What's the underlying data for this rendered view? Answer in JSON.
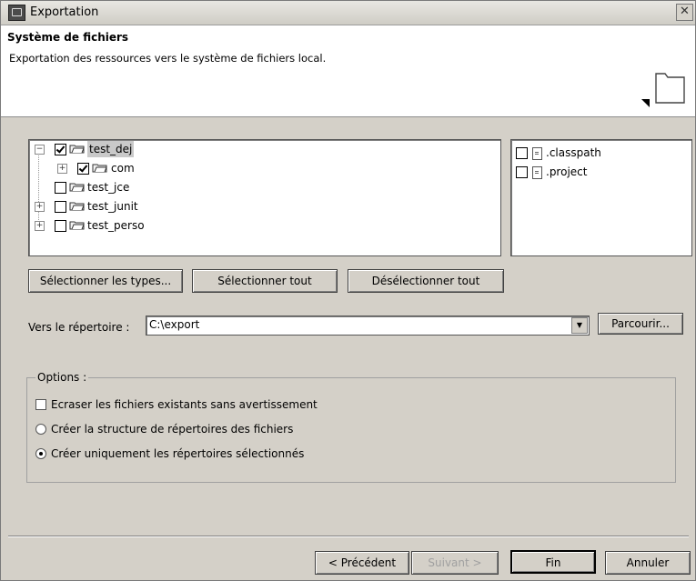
{
  "window": {
    "title": "Exportation"
  },
  "header": {
    "title": "Système de fichiers",
    "description": "Exportation des ressources vers le système de fichiers local."
  },
  "tree": [
    {
      "label": "test_dej",
      "checked": true,
      "expanded": true,
      "level": 0
    },
    {
      "label": "com",
      "checked": true,
      "expanded": false,
      "level": 1
    },
    {
      "label": "test_jce",
      "checked": false,
      "level": 0
    },
    {
      "label": "test_junit",
      "checked": false,
      "expanded": false,
      "level": 0
    },
    {
      "label": "test_perso",
      "checked": false,
      "expanded": false,
      "level": 0
    }
  ],
  "files": [
    {
      "label": ".classpath",
      "checked": false
    },
    {
      "label": ".project",
      "checked": false
    }
  ],
  "buttons": {
    "select_types": "Sélectionner les types...",
    "select_all": "Sélectionner tout",
    "deselect_all": "Désélectionner tout",
    "browse": "Parcourir...",
    "back": "< Précédent",
    "next": "Suivant >",
    "finish": "Fin",
    "cancel": "Annuler"
  },
  "destination": {
    "label": "Vers le répertoire :",
    "value": "C:\\export"
  },
  "options": {
    "legend": "Options :",
    "overwrite": {
      "label": "Ecraser les fichiers existants sans avertissement",
      "checked": false
    },
    "create_structure": {
      "label": "Créer la structure de répertoires des fichiers",
      "selected": false
    },
    "create_selected": {
      "label": "Créer uniquement les répertoires sélectionnés",
      "selected": true
    }
  }
}
